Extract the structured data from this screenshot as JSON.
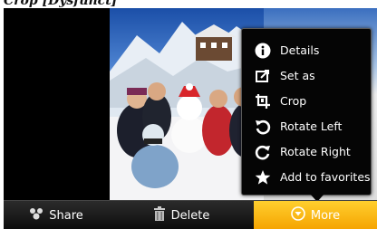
{
  "caption": "Crop [Dysfunct]",
  "bottombar": {
    "share_label": "Share",
    "delete_label": "Delete",
    "more_label": "More"
  },
  "menu": {
    "items": [
      {
        "label": "Details",
        "icon": "info-icon"
      },
      {
        "label": "Set as",
        "icon": "set-as-icon"
      },
      {
        "label": "Crop",
        "icon": "crop-icon"
      },
      {
        "label": "Rotate Left",
        "icon": "rotate-left-icon"
      },
      {
        "label": "Rotate Right",
        "icon": "rotate-right-icon"
      },
      {
        "label": "Add to favorites",
        "icon": "star-icon"
      }
    ]
  },
  "colors": {
    "more_accent": "#f5a300",
    "menu_bg": "#050505"
  }
}
